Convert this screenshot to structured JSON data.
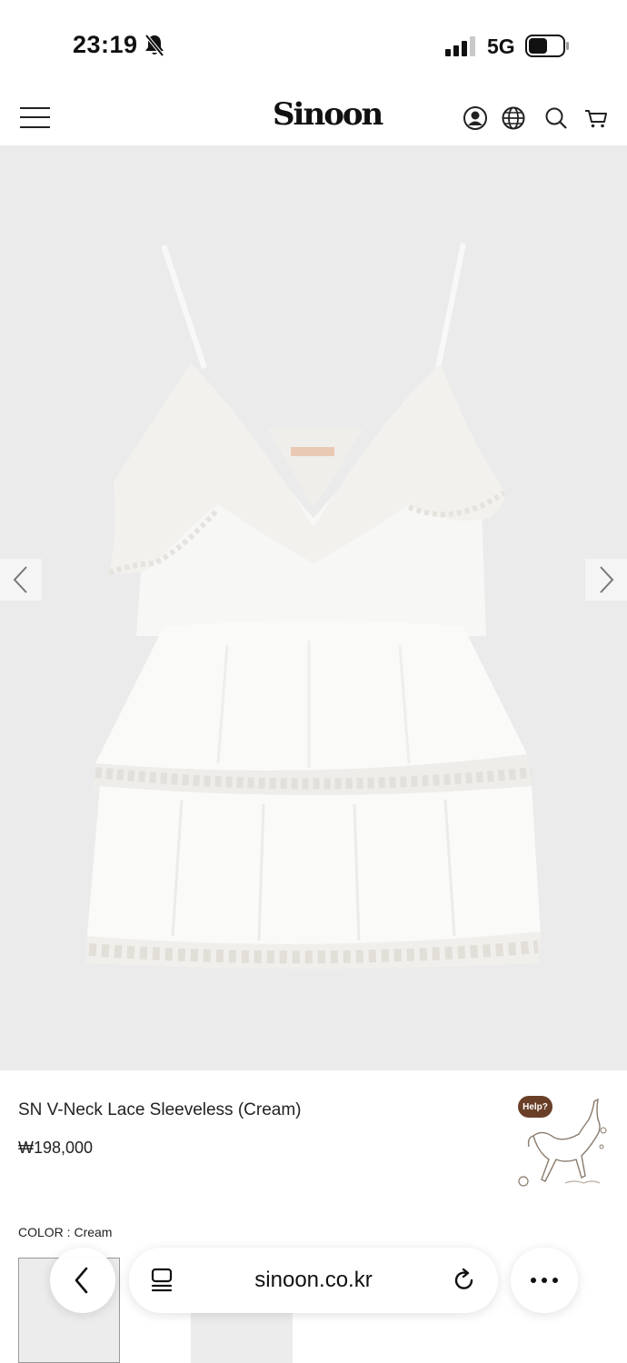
{
  "status_bar": {
    "time": "23:19",
    "network": "5G"
  },
  "header": {
    "logo": "Sinoon"
  },
  "product": {
    "name": "SN V-Neck Lace Sleeveless (Cream)",
    "price": "₩198,000",
    "color_label": "COLOR : Cream"
  },
  "help": {
    "label": "Help?"
  },
  "browser": {
    "url": "sinoon.co.kr"
  },
  "icons": {
    "menu": "hamburger-menu-icon",
    "account": "account-icon",
    "language": "globe-icon",
    "search": "search-icon",
    "cart": "cart-icon",
    "prev": "chevron-left-icon",
    "next": "chevron-right-icon",
    "tabs": "tabs-icon",
    "reload": "reload-icon",
    "more": "more-icon"
  },
  "colors": {
    "gallery_bg": "#ebebeb",
    "help_bubble": "#6a3f28"
  }
}
